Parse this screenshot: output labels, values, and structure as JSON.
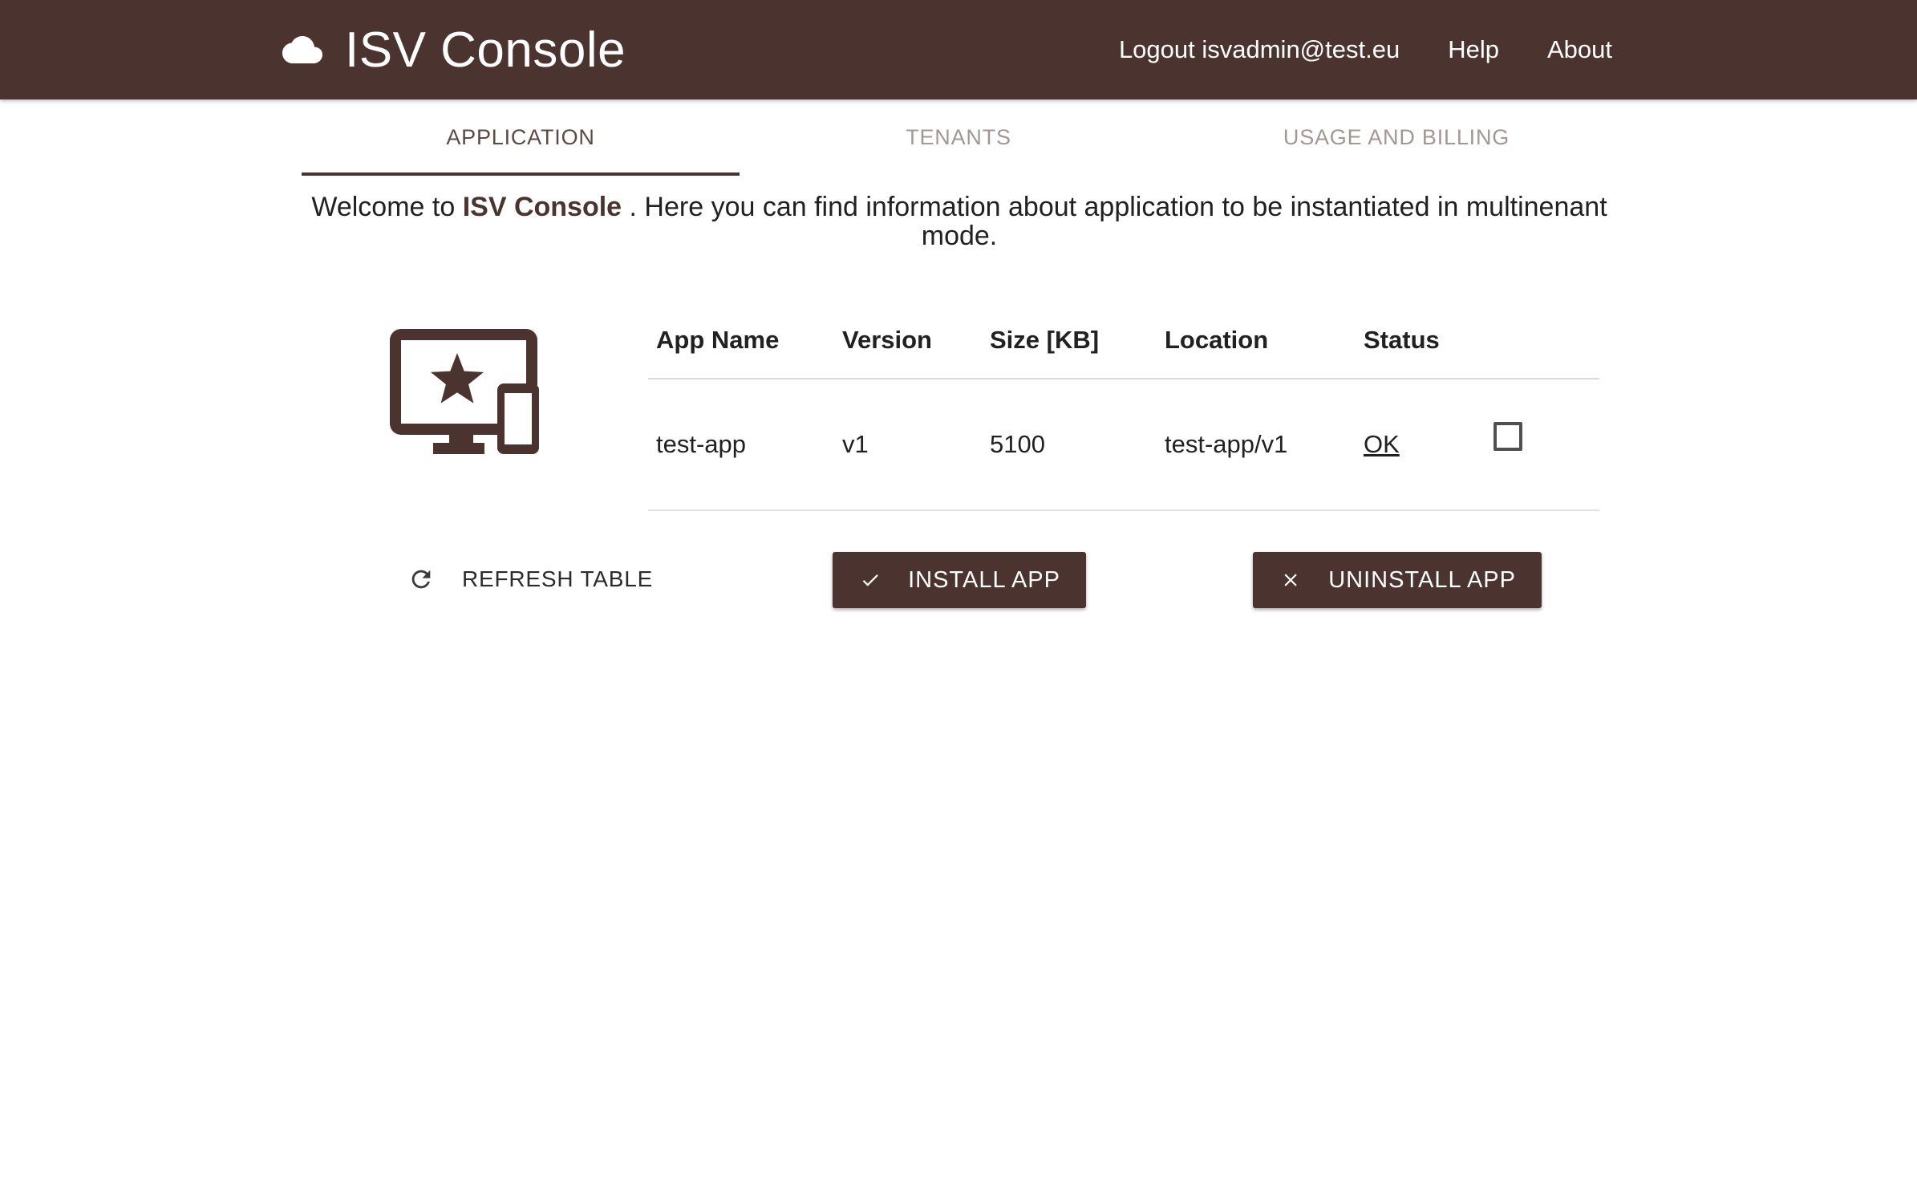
{
  "header": {
    "title": "ISV Console",
    "logout_label": "Logout isvadmin@test.eu",
    "help_label": "Help",
    "about_label": "About",
    "icon": "cloud-icon"
  },
  "tabs": [
    {
      "label": "APPLICATION",
      "active": true
    },
    {
      "label": "TENANTS",
      "active": false
    },
    {
      "label": "USAGE AND BILLING",
      "active": false
    }
  ],
  "intro": {
    "prefix": "Welcome to",
    "brand": "ISV Console",
    "suffix": ". Here you can find information about application to be instantiated in multinenant mode."
  },
  "app_icon": "devices-star-icon",
  "table": {
    "columns": [
      "App Name",
      "Version",
      "Size [KB]",
      "Location",
      "Status"
    ],
    "rows": [
      {
        "app_name": "test-app",
        "version": "v1",
        "size": "5100",
        "location": "test-app/v1",
        "status": "OK",
        "selected": false
      }
    ]
  },
  "actions": {
    "refresh_label": "REFRESH TABLE",
    "install_label": "INSTALL APP",
    "uninstall_label": "UNINSTALL APP"
  },
  "colors": {
    "primary": "#4b3430",
    "tab_inactive": "#a49793",
    "background": "#ffffff"
  }
}
